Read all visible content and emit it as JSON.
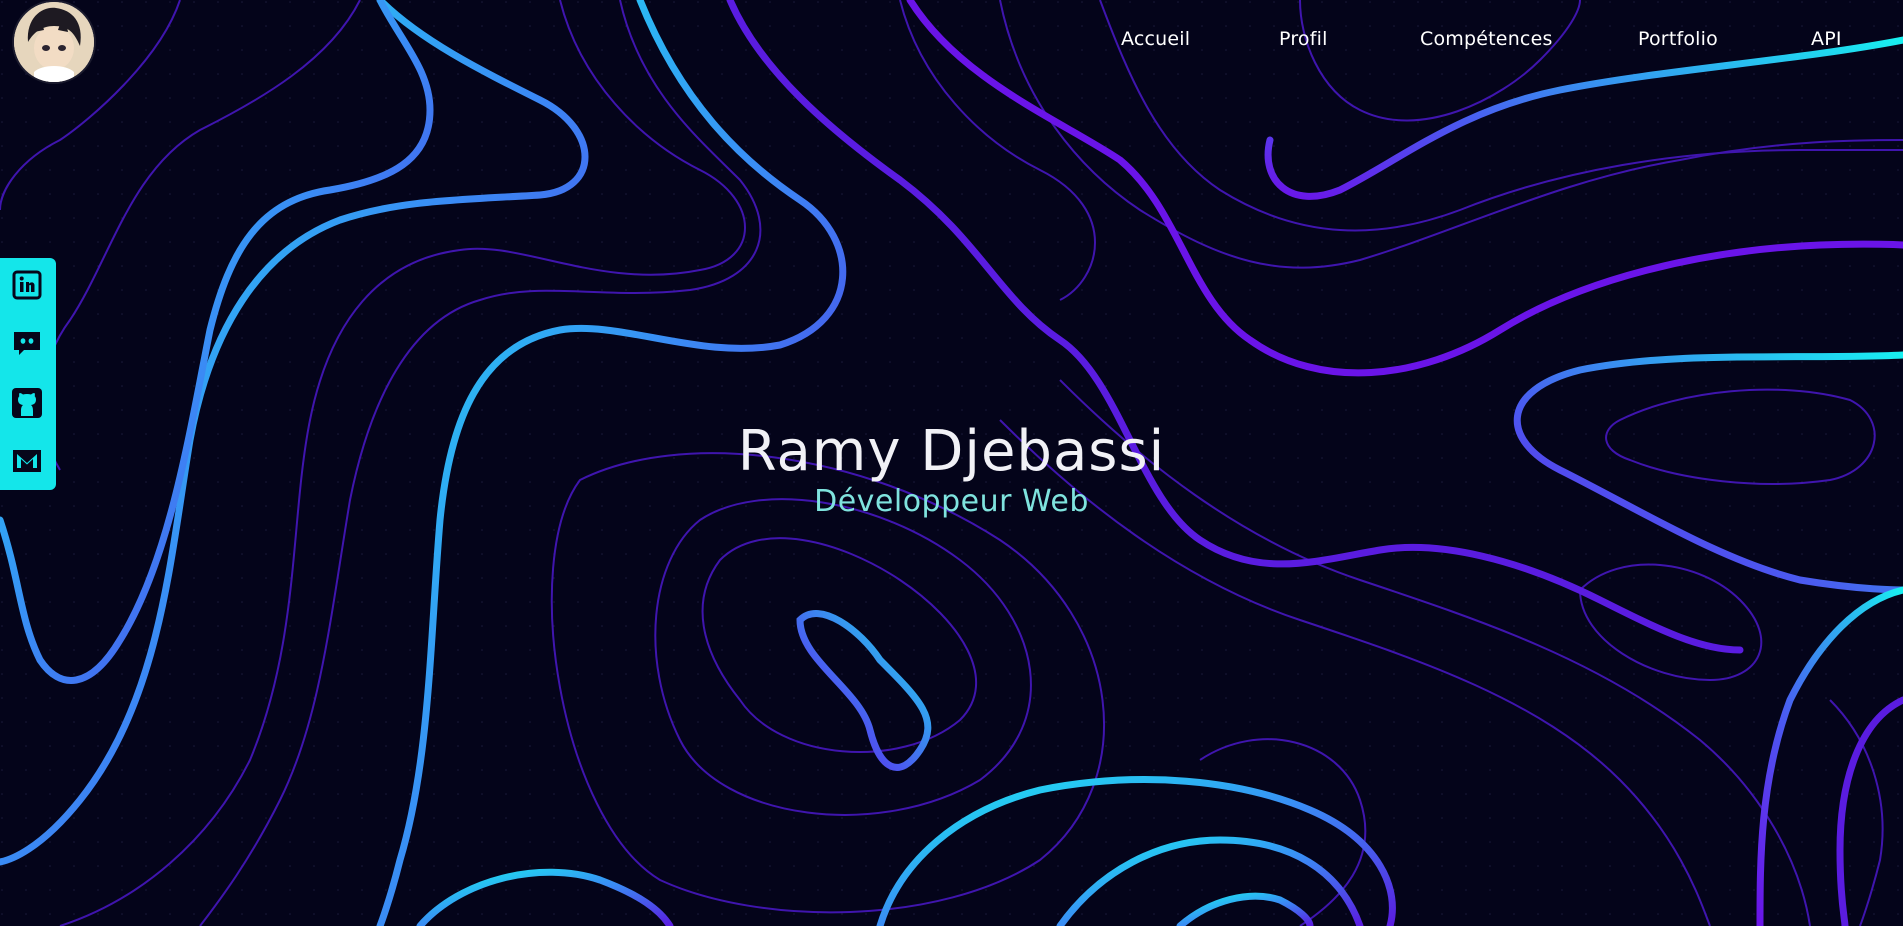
{
  "nav": {
    "items": [
      {
        "label": "Accueil"
      },
      {
        "label": "Profil"
      },
      {
        "label": "Compétences"
      },
      {
        "label": "Portfolio"
      },
      {
        "label": "API"
      }
    ]
  },
  "hero": {
    "name": "Ramy Djebassi",
    "role": "Développeur Web"
  },
  "social": [
    {
      "icon": "linkedin-icon"
    },
    {
      "icon": "discord-icon"
    },
    {
      "icon": "github-icon"
    },
    {
      "icon": "mail-icon"
    }
  ],
  "colors": {
    "background": "#04041a",
    "accent_cyan": "#14e6ea",
    "accent_purple": "#5a1ce0",
    "subtitle": "#7fe3de"
  }
}
